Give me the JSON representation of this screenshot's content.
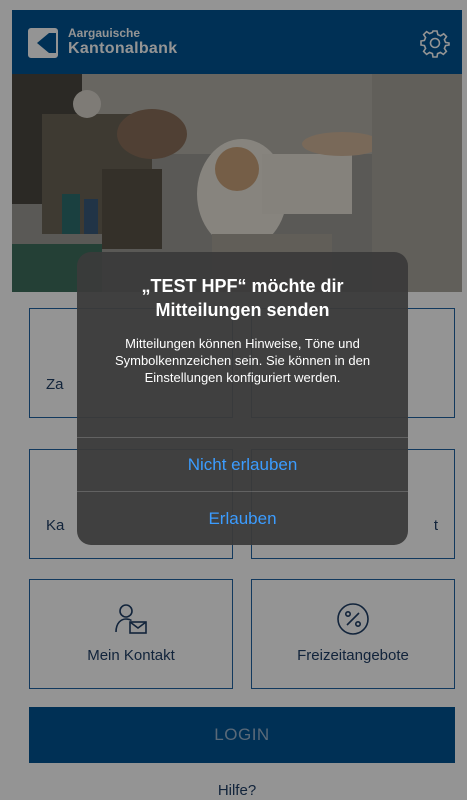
{
  "header": {
    "brand_line1": "Aargauische",
    "brand_line2": "Kantonalbank",
    "settings_icon": "gear-icon",
    "logo_icon": "chevron-left-logo"
  },
  "tiles": [
    {
      "label": "Za",
      "icon": "payment-icon"
    },
    {
      "label": "",
      "icon": "grid-icon"
    },
    {
      "label": "Ka",
      "icon": "card-icon"
    },
    {
      "label": "t",
      "icon": "info-icon"
    },
    {
      "label": "Mein Kontakt",
      "icon": "person-mail-icon"
    },
    {
      "label": "Freizeitangebote",
      "icon": "percent-icon"
    }
  ],
  "login_label": "LOGIN",
  "help_label": "Hilfe?",
  "alert": {
    "title": "„TEST HPF“ möchte dir Mitteilungen senden",
    "message": "Mitteilungen können Hinweise, Töne und Symbolkennzeichen sein. Sie können in den Einstellungen konfiguriert werden.",
    "deny_label": "Nicht erlauben",
    "allow_label": "Erlauben"
  },
  "colors": {
    "brand_blue": "#005493",
    "tile_border": "#1f63a3",
    "alert_button": "#3b9cff"
  }
}
